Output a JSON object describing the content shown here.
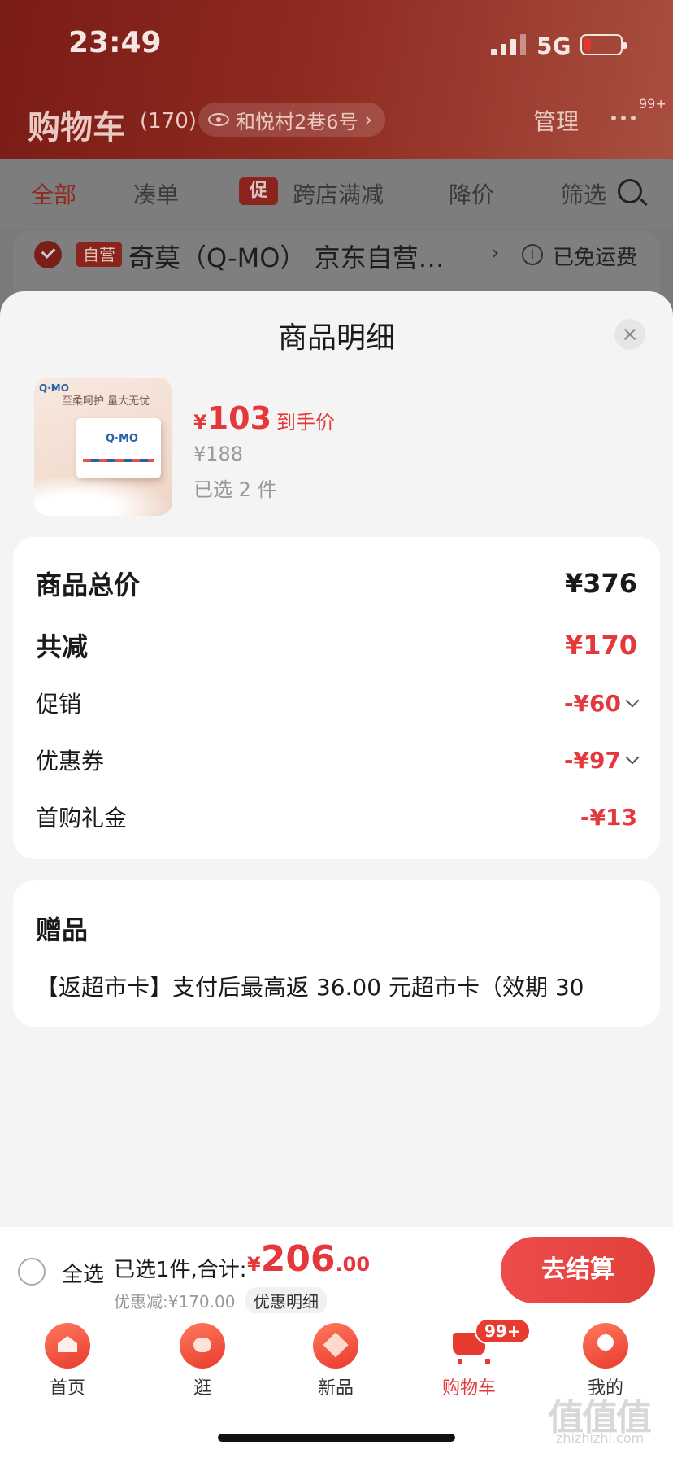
{
  "status": {
    "time": "23:49",
    "network": "5G"
  },
  "background": {
    "title": "购物车",
    "count": "(170)",
    "address": "和悦村2巷6号",
    "manage": "管理",
    "more_badge": "99+",
    "tabs": [
      "全部",
      "凑单",
      "跨店满减",
      "降价",
      "筛选"
    ],
    "promo_tag": "促",
    "store": {
      "self_tag": "自营",
      "name": "奇莫（Q-MO） 京东自营…",
      "shipping": "已免运费"
    }
  },
  "sheet": {
    "title": "商品明细",
    "product": {
      "thumb_logo": "Q·MO",
      "thumb_slogan": "至柔呵护 量大无忧",
      "price_symbol": "¥",
      "price": "103",
      "price_label": "到手价",
      "original_price": "¥188",
      "selected": "已选 2 件"
    },
    "summary": {
      "total_label": "商品总价",
      "total_value": "¥376",
      "reduce_label": "共减",
      "reduce_value": "¥170",
      "promo_label": "促销",
      "promo_value": "-¥60",
      "coupon_label": "优惠券",
      "coupon_value": "-¥97",
      "gift_money_label": "首购礼金",
      "gift_money_value": "-¥13"
    },
    "gifts": {
      "title": "赠品",
      "text": "【返超市卡】支付后最高返 36.00 元超市卡（效期 30"
    }
  },
  "checkout": {
    "select_all": "全选",
    "summary": "已选1件,合计:",
    "total_symbol": "¥",
    "total_int": "206",
    "total_dec": ".00",
    "discount": "优惠减:¥170.00",
    "detail": "优惠明细",
    "pay": "去结算"
  },
  "tabbar": {
    "items": [
      "首页",
      "逛",
      "新品",
      "购物车",
      "我的"
    ],
    "cart_badge": "99+"
  },
  "watermark": {
    "main": "值值值",
    "sub": "zhizhizhi.com"
  }
}
